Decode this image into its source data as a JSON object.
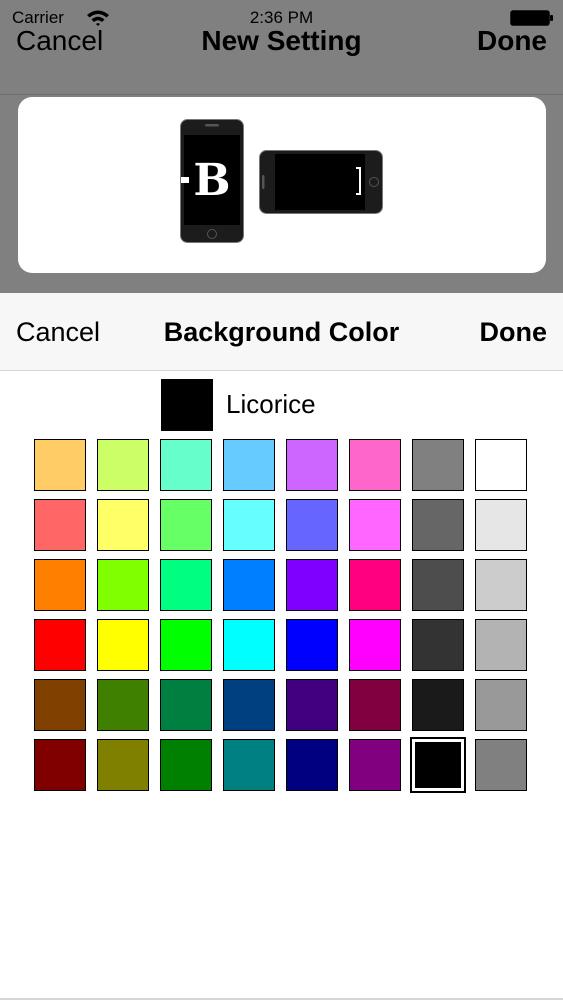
{
  "status_bar": {
    "carrier": "Carrier",
    "time": "2:36 PM",
    "wifi_icon": "wifi-icon",
    "battery_icon": "battery-icon"
  },
  "underlying_nav": {
    "cancel_label": "Cancel",
    "title": "New Setting",
    "done_label": "Done"
  },
  "preview": {
    "portrait_icon": "phone-portrait-icon",
    "landscape_icon": "phone-landscape-icon",
    "glyph": "B"
  },
  "picker": {
    "cancel_label": "Cancel",
    "title": "Background Color",
    "done_label": "Done",
    "selected": {
      "name": "Licorice",
      "color": "#000000"
    },
    "swatch_rows": [
      [
        "#ffcc66",
        "#ccff66",
        "#66ffcc",
        "#66ccff",
        "#cc66ff",
        "#ff66cc",
        "#808080",
        "#ffffff"
      ],
      [
        "#ff6666",
        "#ffff66",
        "#66ff66",
        "#66ffff",
        "#6666ff",
        "#ff66ff",
        "#666666",
        "#e6e6e6"
      ],
      [
        "#ff8000",
        "#80ff00",
        "#00ff80",
        "#0080ff",
        "#8000ff",
        "#ff0080",
        "#4d4d4d",
        "#cccccc"
      ],
      [
        "#ff0000",
        "#ffff00",
        "#00ff00",
        "#00ffff",
        "#0000ff",
        "#ff00ff",
        "#333333",
        "#b3b3b3"
      ],
      [
        "#804000",
        "#408000",
        "#008040",
        "#004080",
        "#400080",
        "#800040",
        "#1a1a1a",
        "#999999"
      ],
      [
        "#800000",
        "#808000",
        "#008000",
        "#008080",
        "#000080",
        "#800080",
        "#000000",
        "#808080"
      ]
    ],
    "selected_index": [
      5,
      6
    ]
  },
  "colors": {
    "dim_overlay": "#808080",
    "sheet_nav_bg": "#f7f7f7",
    "text": "#000000"
  }
}
